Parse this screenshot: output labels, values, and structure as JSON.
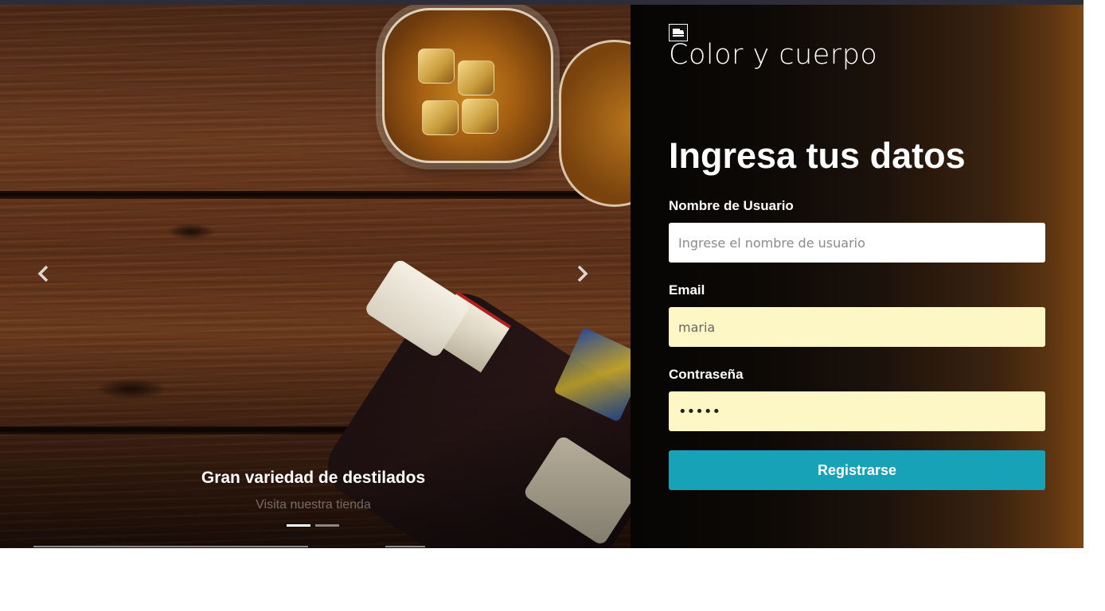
{
  "carousel": {
    "caption_title": "Gran variedad de destilados",
    "caption_subtitle": "Visita nuestra tienda",
    "prev_icon": "chevron-left-icon",
    "next_icon": "chevron-right-icon",
    "slide_count": 2,
    "active_slide": 1
  },
  "brand": {
    "logo_icon": "store-icon",
    "name": "Color y cuerpo"
  },
  "form": {
    "title": "Ingresa tus datos",
    "username": {
      "label": "Nombre de Usuario",
      "placeholder": "Ingrese el nombre de usuario",
      "value": ""
    },
    "email": {
      "label": "Email",
      "value": "maria"
    },
    "password": {
      "label": "Contraseña",
      "value": "•••••"
    },
    "submit_label": "Registrarse"
  },
  "colors": {
    "button": "#17a2b8",
    "autofill": "#fdf7c6",
    "panel_accent": "#7a4613"
  }
}
